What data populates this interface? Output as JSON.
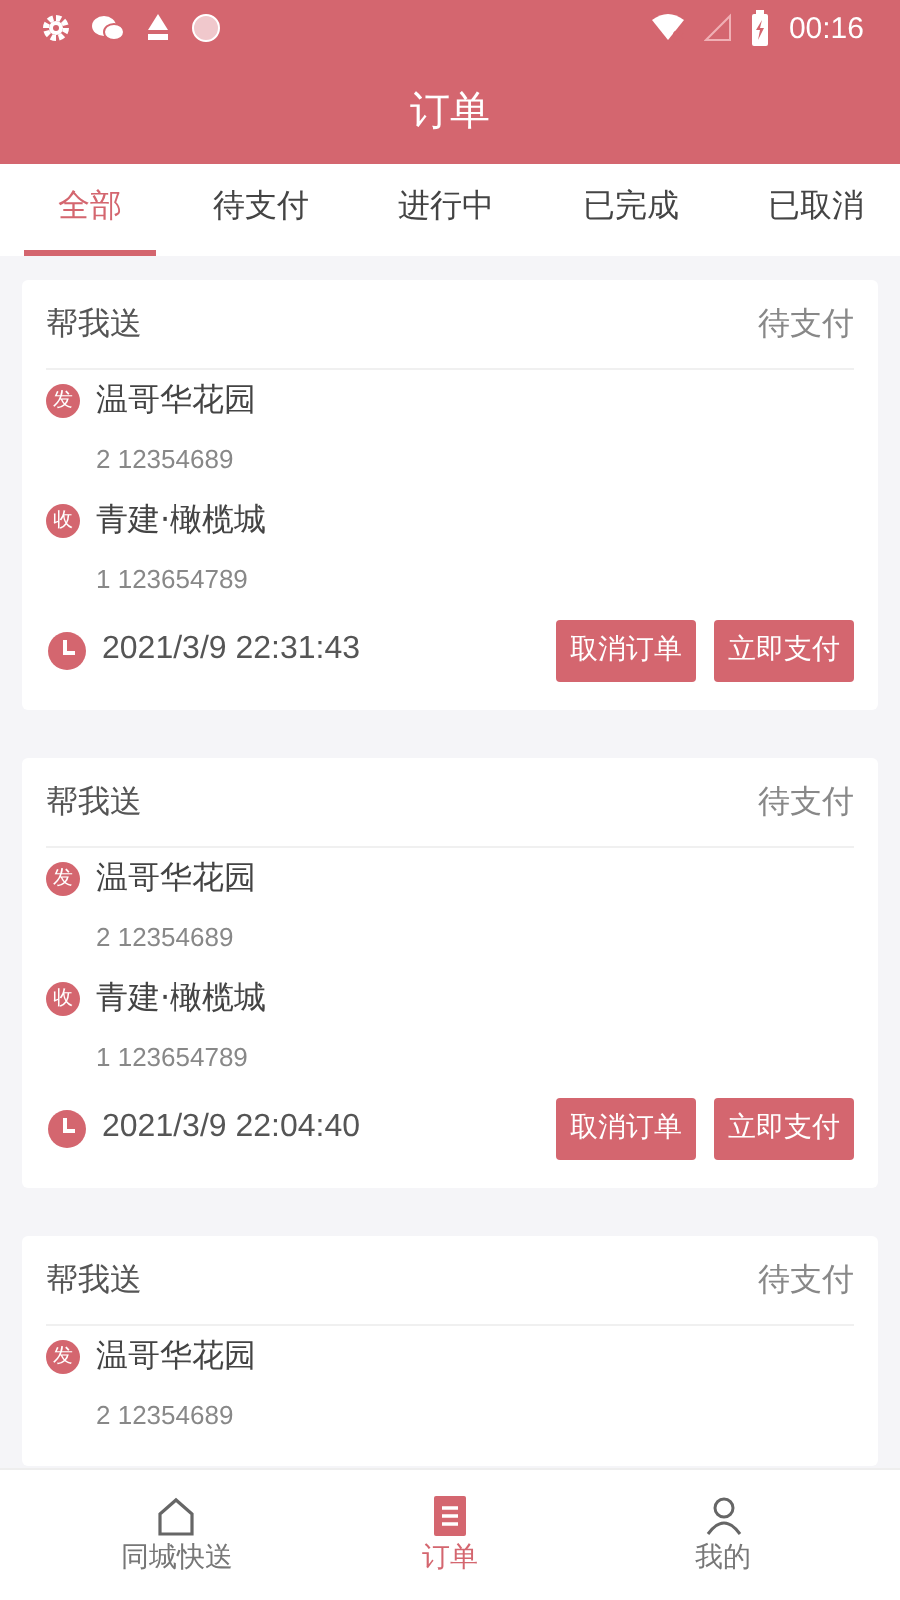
{
  "status_bar": {
    "time": "00:16"
  },
  "header": {
    "title": "订单"
  },
  "tabs": [
    {
      "label": "全部",
      "selected": true
    },
    {
      "label": "待支付",
      "selected": false
    },
    {
      "label": "进行中",
      "selected": false
    },
    {
      "label": "已完成",
      "selected": false
    },
    {
      "label": "已取消",
      "selected": false
    }
  ],
  "orders": [
    {
      "type": "帮我送",
      "status": "待支付",
      "sender": {
        "badge": "发",
        "place": "温哥华花园",
        "phone": "2 12354689"
      },
      "receiver": {
        "badge": "收",
        "place": "青建·橄榄城",
        "phone": "1 123654789"
      },
      "time": "2021/3/9 22:31:43",
      "buttons": [
        "取消订单",
        "立即支付"
      ]
    },
    {
      "type": "帮我送",
      "status": "待支付",
      "sender": {
        "badge": "发",
        "place": "温哥华花园",
        "phone": "2 12354689"
      },
      "receiver": {
        "badge": "收",
        "place": "青建·橄榄城",
        "phone": "1 123654789"
      },
      "time": "2021/3/9 22:04:40",
      "buttons": [
        "取消订单",
        "立即支付"
      ]
    },
    {
      "type": "帮我送",
      "status": "待支付",
      "sender": {
        "badge": "发",
        "place": "温哥华花园",
        "phone": "2 12354689"
      }
    }
  ],
  "bottom_nav": [
    {
      "label": "同城快送",
      "kind": "home",
      "selected": false
    },
    {
      "label": "订单",
      "kind": "orders",
      "selected": true
    },
    {
      "label": "我的",
      "kind": "profile",
      "selected": false
    }
  ]
}
